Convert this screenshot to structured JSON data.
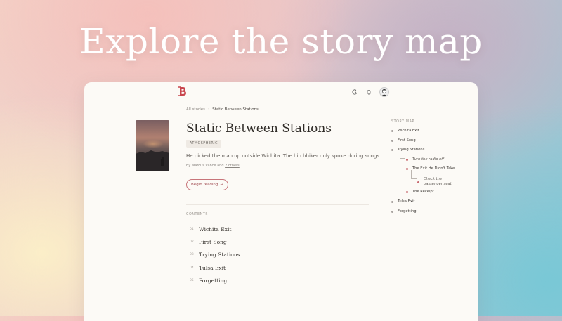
{
  "headline": "Explore the story map",
  "header": {
    "icons": [
      "moon-icon",
      "bell-icon",
      "avatar"
    ]
  },
  "breadcrumb": {
    "root": "All stories",
    "separator": "›",
    "current": "Static Between Stations"
  },
  "story": {
    "title": "Static Between Stations",
    "tag": "ATMOSPHERIC",
    "description": "He picked the man up outside Wichita. The hitchhiker only spoke during songs.",
    "byline_prefix": "By Marcus Vance and ",
    "byline_others": "2 others",
    "begin_label": "Begin reading",
    "begin_arrow": "→"
  },
  "contents": {
    "label": "CONTENTS",
    "chapters": [
      {
        "num": "01",
        "name": "Wichita Exit"
      },
      {
        "num": "02",
        "name": "First Song"
      },
      {
        "num": "03",
        "name": "Trying Stations"
      },
      {
        "num": "04",
        "name": "Tulsa Exit"
      },
      {
        "num": "05",
        "name": "Forgetting"
      }
    ]
  },
  "story_map": {
    "label": "STORY MAP",
    "nodes": [
      {
        "label": "Wichita Exit",
        "depth": 0,
        "italic": false
      },
      {
        "label": "First Song",
        "depth": 0,
        "italic": false
      },
      {
        "label": "Trying Stations",
        "depth": 0,
        "italic": false
      },
      {
        "label": "Turn the radio off",
        "depth": 1,
        "italic": true
      },
      {
        "label": "The Exit He Didn't Take",
        "depth": 1,
        "italic": false
      },
      {
        "label": "Check the passenger seat",
        "depth": 2,
        "italic": true
      },
      {
        "label": "The Receipt",
        "depth": 1,
        "italic": false
      },
      {
        "label": "Tulsa Exit",
        "depth": 0,
        "italic": false
      },
      {
        "label": "Forgetting",
        "depth": 0,
        "italic": false
      }
    ]
  },
  "colors": {
    "accent": "#c8565c",
    "node_dot": "#a8a3a0",
    "branch_dot": "#c86a70"
  }
}
